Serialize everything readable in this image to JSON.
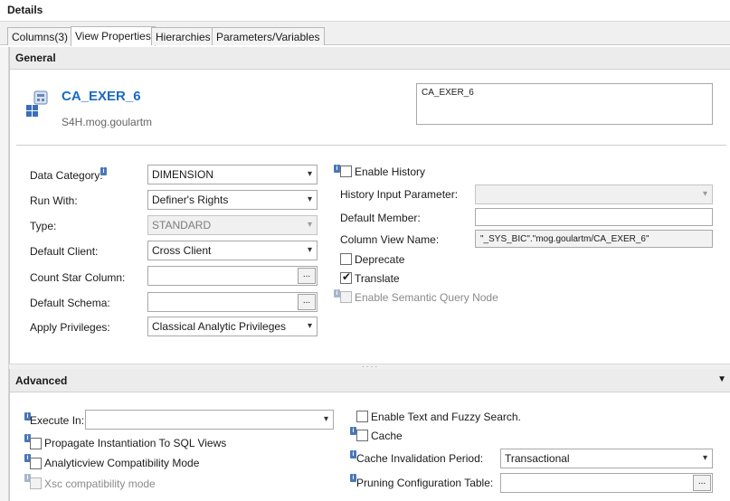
{
  "panel": {
    "title": "Details"
  },
  "tabs": [
    {
      "label": "Columns(3)"
    },
    {
      "label": "View Properties"
    },
    {
      "label": "Hierarchies"
    },
    {
      "label": "Parameters/Variables"
    }
  ],
  "general": {
    "header": "General",
    "view_name": "CA_EXER_6",
    "package": "S4H.mog.goulartm",
    "description": "CA_EXER_6",
    "data_category": {
      "label": "Data Category:",
      "value": "DIMENSION"
    },
    "run_with": {
      "label": "Run With:",
      "value": "Definer's Rights"
    },
    "type": {
      "label": "Type:",
      "value": "STANDARD"
    },
    "default_client": {
      "label": "Default Client:",
      "value": "Cross Client"
    },
    "count_star": {
      "label": "Count Star Column:",
      "value": "",
      "browse": "..."
    },
    "default_schema": {
      "label": "Default Schema:",
      "value": "",
      "browse": "..."
    },
    "apply_privileges": {
      "label": "Apply Privileges:",
      "value": "Classical Analytic Privileges"
    },
    "enable_history": {
      "label": "Enable History",
      "checked": false
    },
    "history_input": {
      "label": "History Input Parameter:",
      "value": ""
    },
    "default_member": {
      "label": "Default Member:",
      "value": ""
    },
    "column_view_name": {
      "label": "Column View Name:",
      "value": "\"_SYS_BIC\".\"mog.goulartm/CA_EXER_6\""
    },
    "deprecate": {
      "label": "Deprecate",
      "checked": false
    },
    "translate": {
      "label": "Translate",
      "checked": true
    },
    "semantic_query": {
      "label": "Enable Semantic Query Node",
      "checked": false
    }
  },
  "advanced": {
    "header": "Advanced",
    "execute_in": {
      "label": "Execute In:",
      "value": ""
    },
    "propagate": {
      "label": "Propagate Instantiation To SQL Views",
      "checked": false
    },
    "compat_mode": {
      "label": "Analyticview Compatibility Mode",
      "checked": false
    },
    "xsc_compat": {
      "label": "Xsc compatibility mode",
      "checked": false
    },
    "text_fuzzy": {
      "label": "Enable Text and Fuzzy Search.",
      "checked": false
    },
    "cache": {
      "label": "Cache",
      "checked": false
    },
    "cache_period": {
      "label": "Cache Invalidation Period:",
      "value": "Transactional"
    },
    "pruning": {
      "label": "Pruning Configuration Table:",
      "value": "",
      "browse": "..."
    }
  },
  "icons": {
    "info": "info-icon",
    "checkmark": "✔",
    "dropdown": "▾",
    "collapse": "▼",
    "sash": "· · · ·",
    "info_glyph": "i"
  },
  "colors": {
    "link_title": "#1a6ac6",
    "info_badge": "#4a77b6",
    "section_header": "#ececec"
  }
}
